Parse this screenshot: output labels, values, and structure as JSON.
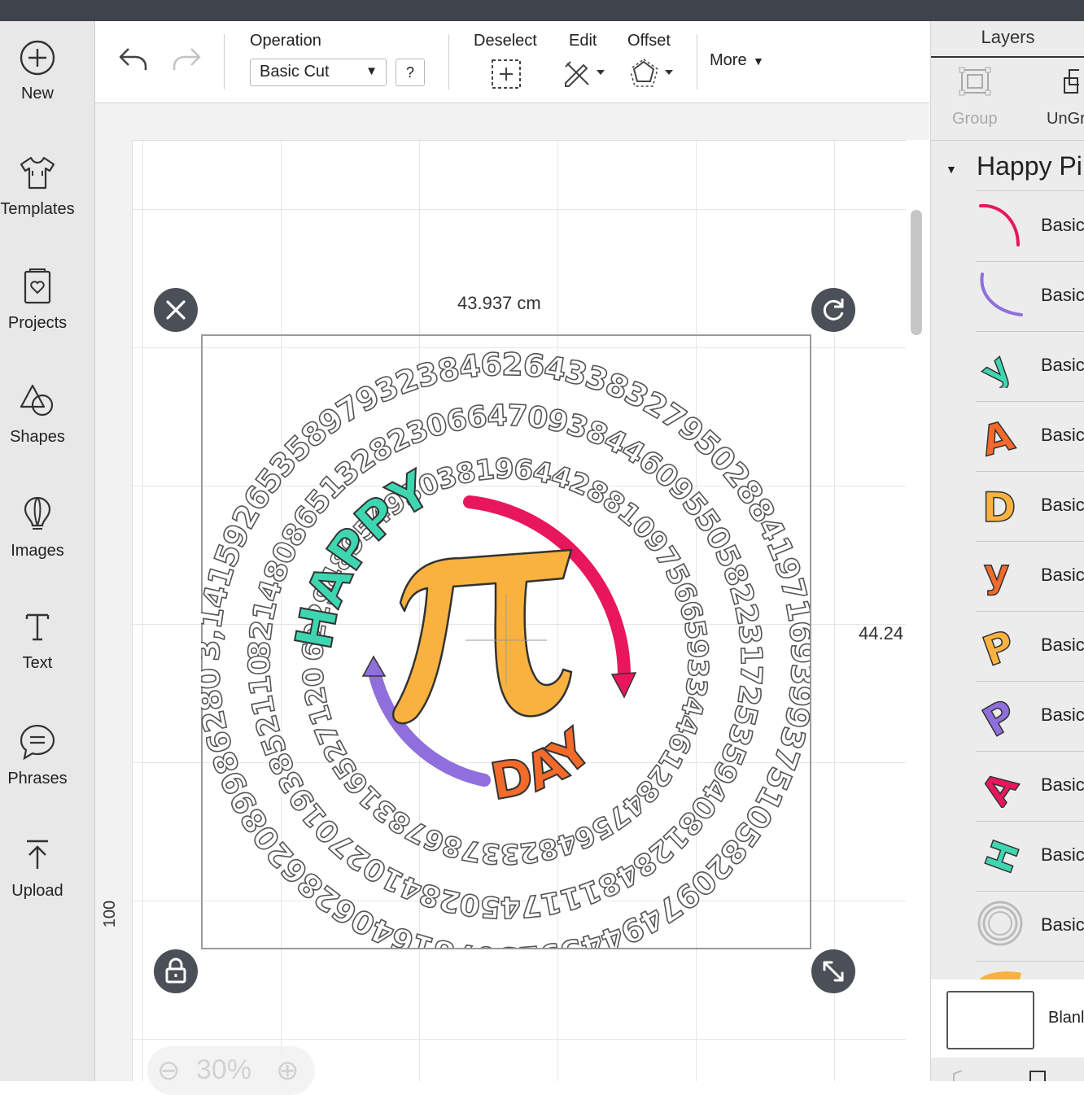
{
  "sidebar": {
    "items": [
      {
        "label": "New",
        "icon": "plus-circle-icon"
      },
      {
        "label": "Templates",
        "icon": "shirt-icon"
      },
      {
        "label": "Projects",
        "icon": "heart-card-icon"
      },
      {
        "label": "Shapes",
        "icon": "shapes-icon"
      },
      {
        "label": "Images",
        "icon": "lightbulb-icon"
      },
      {
        "label": "Text",
        "icon": "text-t-icon"
      },
      {
        "label": "Phrases",
        "icon": "speech-bubble-icon"
      },
      {
        "label": "Upload",
        "icon": "upload-icon"
      }
    ]
  },
  "toolbar": {
    "operation_label": "Operation",
    "operation_value": "Basic Cut",
    "help_label": "?",
    "deselect_label": "Deselect",
    "edit_label": "Edit",
    "offset_label": "Offset",
    "more_label": "More"
  },
  "canvas": {
    "width_label": "43.937 cm",
    "height_label": "44.24",
    "ruler_mark": "100",
    "zoom_label": "30%",
    "pi_digits_ring1": "3,14159265358979323846264338327950288419716939937510582097494459230781640628620899862803482534211706798214808651328230664709384460955058223172535940812848111745028410270193852110555964462294895493038196442881097566593344612847564823378...",
    "pi_digits_ring2": "82148086513282306647093844609550582231725359408128481117450284102701938521105559644622948954930381964428810975665933446128475648233786783165271201909145648566923460348610454326648213393607260249141273",
    "pi_digits_ring3": "622948954930381964428810975665933446128475648233786783165271201909145648566923460348610454326648213393607260249141273",
    "happy_text": "HAPPY",
    "day_text": "DAY"
  },
  "layers": {
    "title": "Layers",
    "group_label": "Group",
    "ungroup_label": "UnGr",
    "group_name": "Happy Pi",
    "rows": [
      {
        "name": "Basic",
        "thumb": "pink-arc"
      },
      {
        "name": "Basic",
        "thumb": "purple-arc"
      },
      {
        "name": "Basic",
        "thumb": "teal-Y"
      },
      {
        "name": "Basic",
        "thumb": "orange-A"
      },
      {
        "name": "Basic",
        "thumb": "yellow-D"
      },
      {
        "name": "Basic",
        "thumb": "orange-Y"
      },
      {
        "name": "Basic",
        "thumb": "yellow-P"
      },
      {
        "name": "Basic",
        "thumb": "purple-P"
      },
      {
        "name": "Basic",
        "thumb": "pink-A"
      },
      {
        "name": "Basic",
        "thumb": "teal-H"
      },
      {
        "name": "Basic",
        "thumb": "ring-outline"
      }
    ],
    "blank_label": "Blanl"
  },
  "colors": {
    "pink": "#e8175d",
    "purple": "#8f6fdc",
    "teal": "#3ed6b0",
    "orange": "#f36a2a",
    "yellow": "#f9b23f",
    "dark": "#4b4f57"
  }
}
